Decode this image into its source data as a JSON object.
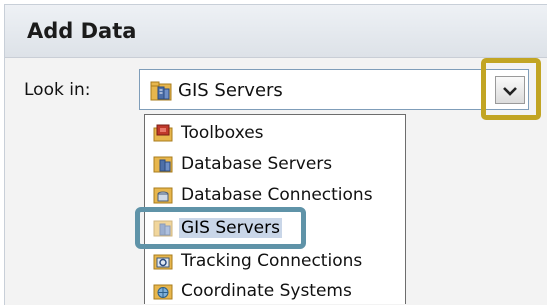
{
  "dialog": {
    "title": "Add Data"
  },
  "look_in": {
    "label": "Look in:",
    "selected_icon": "gis-servers-icon",
    "selected": "GIS Servers"
  },
  "dropdown": {
    "items": [
      {
        "label": "Toolboxes",
        "icon": "toolbox-icon"
      },
      {
        "label": "Database Servers",
        "icon": "database-servers-icon"
      },
      {
        "label": "Database Connections",
        "icon": "database-connections-icon"
      },
      {
        "label": "GIS Servers",
        "icon": "gis-servers-icon"
      },
      {
        "label": "Tracking Connections",
        "icon": "tracking-connections-icon"
      },
      {
        "label": "Coordinate Systems",
        "icon": "coordinate-systems-icon"
      }
    ]
  },
  "colors": {
    "gold_highlight": "#c2a523",
    "blue_highlight": "#5f93a8",
    "selection": "#c9d6e8"
  }
}
